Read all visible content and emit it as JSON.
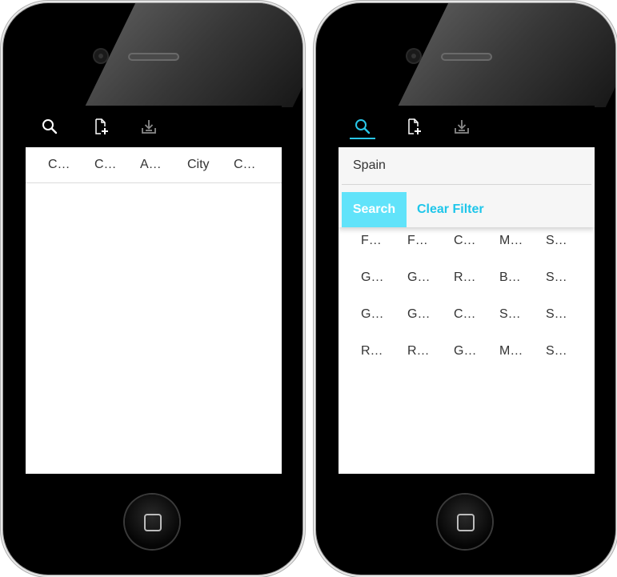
{
  "colors": {
    "accent": "#29c7e8",
    "search_button_bg": "#61e3fa",
    "clear_filter_text": "#1ec6ea",
    "toolbar_bg": "#000000"
  },
  "toolbar": {
    "icons": [
      "search-icon",
      "new-document-icon",
      "download-icon"
    ]
  },
  "left_screen": {
    "columns": [
      "C…",
      "C…",
      "A…",
      "City",
      "C…"
    ]
  },
  "right_screen": {
    "filter": {
      "value": "Spain",
      "search_label": "Search",
      "clear_label": "Clear Filter"
    },
    "rows": [
      [
        "F…",
        "F…",
        "C…",
        "M…",
        "S…"
      ],
      [
        "G…",
        "G…",
        "R…",
        "B…",
        "S…"
      ],
      [
        "G…",
        "G…",
        "C…",
        "S…",
        "S…"
      ],
      [
        "R…",
        "R…",
        "G…",
        "M…",
        "S…"
      ]
    ]
  }
}
